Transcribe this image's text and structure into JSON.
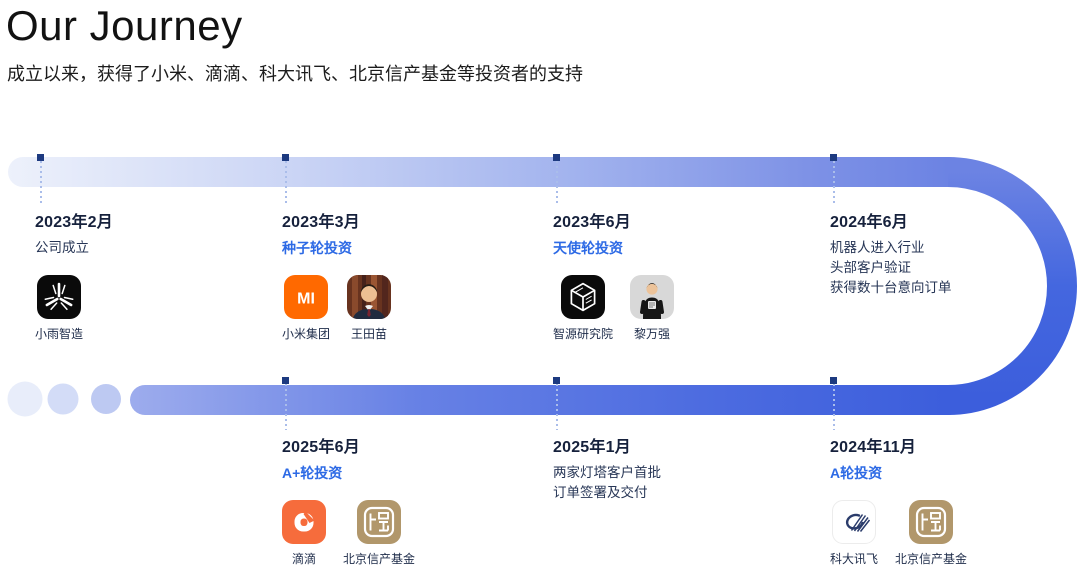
{
  "header": {
    "title": "Our Journey",
    "subtitle": "成立以来，获得了小米、滴滴、科大讯飞、北京信产基金等投资者的支持"
  },
  "colors": {
    "accent_blue": "#2d6ae5",
    "track_deep_blue": "#3c5edc",
    "track_light": "#edf1fb",
    "marker_navy": "#1d3a80",
    "date_text": "#16213c",
    "xiaomi_orange": "#ff6900",
    "didi_orange": "#f66c3c",
    "fund_gold": "#b1976b"
  },
  "timeline": {
    "top": [
      {
        "date": "2023年2月",
        "lines": [
          "公司成立"
        ],
        "logos": [
          {
            "icon": "xiaoyu-logo",
            "label": "小雨智造"
          }
        ]
      },
      {
        "date": "2023年3月",
        "round": "种子轮投资",
        "logos": [
          {
            "icon": "xiaomi-logo",
            "label": "小米集团"
          },
          {
            "icon": "wang-tianmiao-avatar",
            "label": "王田苗"
          }
        ]
      },
      {
        "date": "2023年6月",
        "round": "天使轮投资",
        "logos": [
          {
            "icon": "zhiyuan-logo",
            "label": "智源研究院"
          },
          {
            "icon": "li-wanqiang-avatar",
            "label": "黎万强"
          }
        ]
      },
      {
        "date": "2024年6月",
        "lines": [
          "机器人进入行业",
          "头部客户验证",
          "获得数十台意向订单"
        ]
      }
    ],
    "bottom": [
      {
        "date": "2025年6月",
        "round": "A+轮投资",
        "logos": [
          {
            "icon": "didi-logo",
            "label": "滴滴"
          },
          {
            "icon": "bjxc-fund-logo",
            "label": "北京信产基金"
          }
        ]
      },
      {
        "date": "2025年1月",
        "lines": [
          "两家灯塔客户首批",
          "订单签署及交付"
        ]
      },
      {
        "date": "2024年11月",
        "round": "A轮投资",
        "logos": [
          {
            "icon": "iflytek-logo",
            "label": "科大讯飞"
          },
          {
            "icon": "bjxc-fund-logo",
            "label": "北京信产基金"
          }
        ]
      }
    ]
  }
}
